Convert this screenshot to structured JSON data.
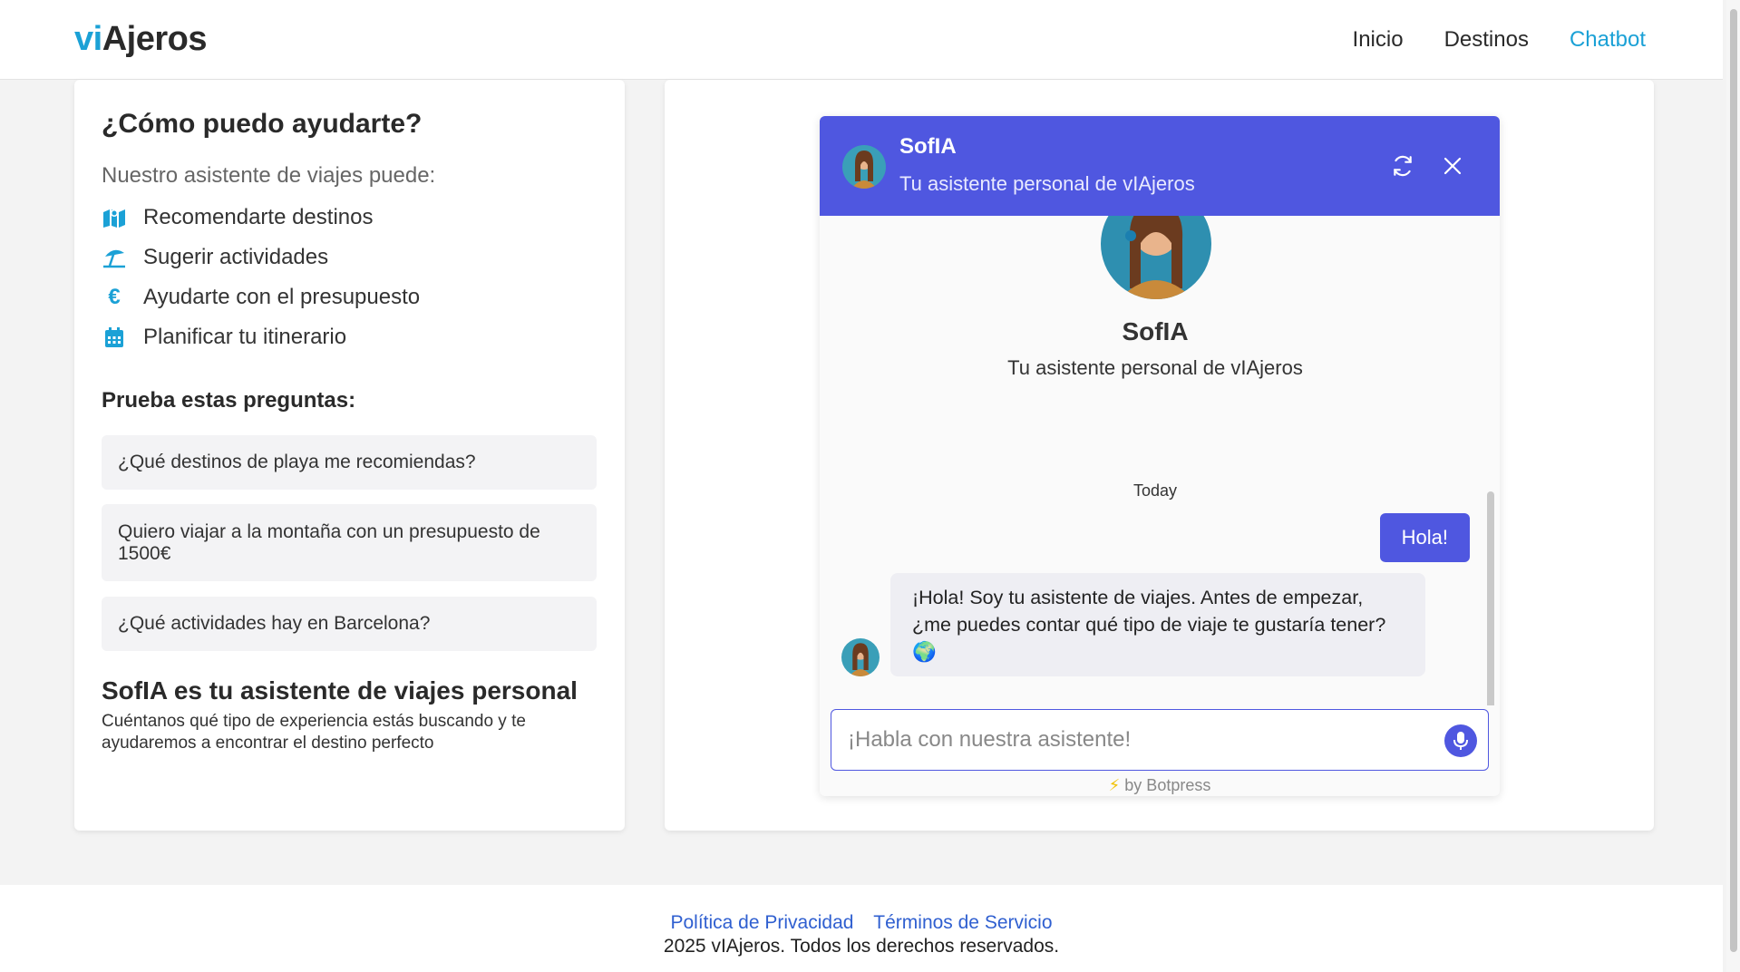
{
  "header": {
    "logo_accent": "vi",
    "logo_rest": "Ajeros",
    "nav": [
      {
        "label": "Inicio"
      },
      {
        "label": "Destinos"
      },
      {
        "label": "Chatbot",
        "active": true
      }
    ]
  },
  "left_panel": {
    "title": "¿Cómo puedo ayudarte?",
    "subtitle": "Nuestro asistente de viajes puede:",
    "features": [
      {
        "icon": "map-icon",
        "label": "Recomendarte destinos"
      },
      {
        "icon": "beach-umbrella-icon",
        "label": "Sugerir actividades"
      },
      {
        "icon": "euro-icon",
        "label": "Ayudarte con el presupuesto"
      },
      {
        "icon": "calendar-icon",
        "label": "Planificar tu itinerario"
      }
    ],
    "try_title": "Prueba estas preguntas:",
    "questions": [
      "¿Qué destinos de playa me recomiendas?",
      "Quiero viajar a la montaña con un presupuesto de 1500€",
      "¿Qué actividades hay en Barcelona?"
    ],
    "promo_title": "SofIA es tu asistente de viajes personal",
    "promo_text": "Cuéntanos qué tipo de experiencia estás buscando y te ayudaremos a encontrar el destino perfecto"
  },
  "chat": {
    "header_name": "SofIA",
    "header_subtitle": "Tu asistente personal de vIAjeros",
    "bot_name": "SofIA",
    "bot_subtitle": "Tu asistente personal de vIAjeros",
    "date_divider": "Today",
    "messages": [
      {
        "from": "user",
        "text": "Hola!"
      },
      {
        "from": "bot",
        "text": "¡Hola! Soy tu asistente de viajes. Antes de empezar, ¿me puedes contar qué tipo de viaje te gustaría tener? 🌍"
      }
    ],
    "input_placeholder": "¡Habla con nuestra asistente!",
    "powered_by": "by Botpress",
    "colors": {
      "primary": "#4f57e0"
    }
  },
  "footer": {
    "privacy": "Política de Privacidad",
    "terms": "Términos de Servicio",
    "copyright": "2025 vIAjeros. Todos los derechos reservados."
  },
  "colors": {
    "accent": "#1ba1d6",
    "link": "#2f5fd0"
  }
}
